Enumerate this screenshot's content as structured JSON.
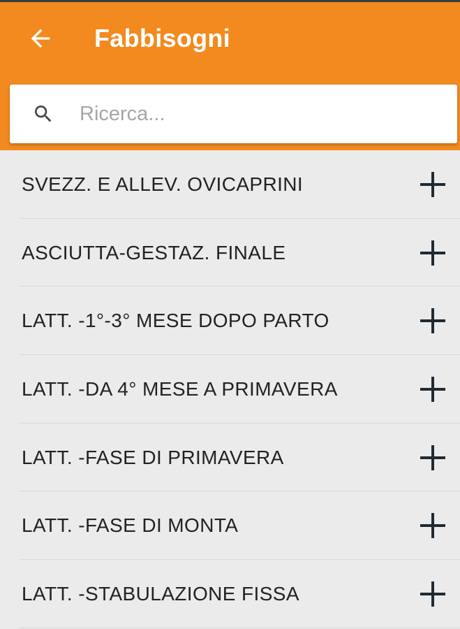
{
  "colors": {
    "app_bar": "#f28a1f",
    "background": "#ebebeb",
    "title_text": "#ffffff",
    "item_text": "#222222",
    "icon": "#1f2a33"
  },
  "header": {
    "back_icon": "arrow-back-icon",
    "title": "Fabbisogni"
  },
  "search": {
    "icon": "search-icon",
    "placeholder": "Ricerca...",
    "value": ""
  },
  "list": {
    "items": [
      {
        "label": "SVEZZ. E ALLEV. OVICAPRINI",
        "action_icon": "plus-icon"
      },
      {
        "label": "ASCIUTTA-GESTAZ. FINALE",
        "action_icon": "plus-icon"
      },
      {
        "label": "LATT. -1°-3° MESE DOPO PARTO",
        "action_icon": "plus-icon"
      },
      {
        "label": "LATT. -DA 4° MESE A PRIMAVERA",
        "action_icon": "plus-icon"
      },
      {
        "label": "LATT. -FASE DI PRIMAVERA",
        "action_icon": "plus-icon"
      },
      {
        "label": "LATT. -FASE DI MONTA",
        "action_icon": "plus-icon"
      },
      {
        "label": "LATT. -STABULAZIONE FISSA",
        "action_icon": "plus-icon"
      }
    ]
  }
}
